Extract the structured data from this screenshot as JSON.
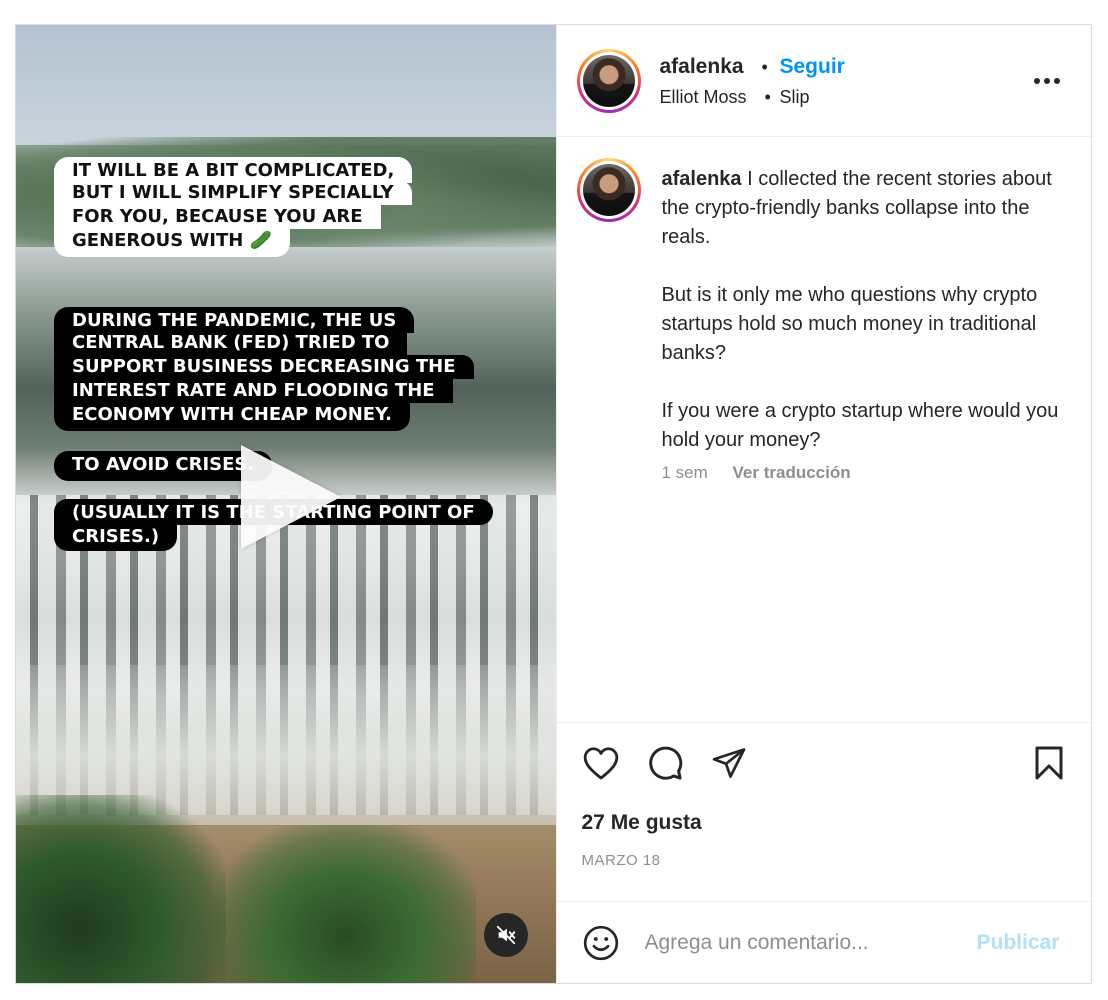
{
  "post": {
    "author": {
      "username": "afalenka",
      "follow_label": "Seguir",
      "audio": "Elliot Moss",
      "audio_sep": "•",
      "audio_title": "Slip",
      "dot": "•"
    },
    "media": {
      "captions": [
        "IT WILL BE A BIT COMPLICATED,",
        "BUT I WILL  SIMPLIFY SPECIALLY",
        "FOR YOU, BECAUSE YOU ARE",
        "GENEROUS WITH 🥒",
        "DURING THE PANDEMIC, THE US",
        "CENTRAL BANK (FED) TRIED TO",
        "SUPPORT BUSINESS DECREASING THE",
        "INTEREST RATE AND FLOODING THE",
        "ECONOMY WITH CHEAP MONEY.",
        "TO AVOID CRISES.",
        "(USUALLY IT IS THE STARTING POINT OF",
        "CRISES.)"
      ]
    },
    "caption": {
      "username": "afalenka",
      "paragraphs": [
        "I collected the recent stories about the crypto-friendly banks collapse into the reals.",
        "But is it only me who questions why crypto startups hold so much money in traditional banks?",
        "If you were a crypto startup where would you hold your money?"
      ],
      "time": "1 sem",
      "translate_label": "Ver traducción"
    },
    "likes": "27 Me gusta",
    "date": "MARZO 18",
    "composer": {
      "placeholder": "Agrega un comentario...",
      "publish_label": "Publicar"
    },
    "icons": {
      "like": "heart-icon",
      "comment": "comment-icon",
      "share": "send-icon",
      "save": "bookmark-icon",
      "emoji": "emoji-icon",
      "mute": "speaker-muted-icon",
      "more": "more-icon",
      "play": "play-icon"
    },
    "colors": {
      "link": "#0095f6",
      "publish_disabled": "#b2dffc",
      "secondary_text": "#8e8e8e"
    }
  }
}
